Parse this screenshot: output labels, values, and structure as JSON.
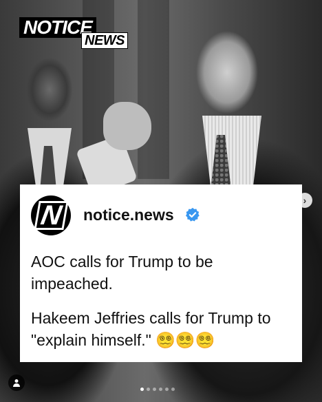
{
  "brand": {
    "logo_main": "NOTICE",
    "logo_sub": "NEWS"
  },
  "post": {
    "avatar_letter": "N",
    "username": "notice.news",
    "verified_color": "#3897f0",
    "line1": "AOC calls for Trump to be impeached.",
    "line2": "Hakeem Jeffries calls for Trump to \"explain himself.\" 😵‍💫😵‍💫😵‍💫"
  },
  "carousel": {
    "slide_count": 6,
    "active_index": 0
  },
  "icons": {
    "next": "chevron-right-icon",
    "tag": "person-icon"
  }
}
